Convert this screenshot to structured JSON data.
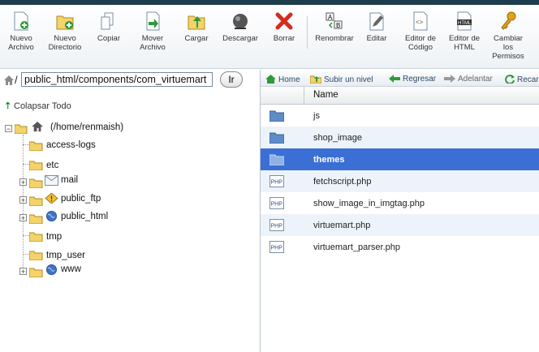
{
  "toolbar": {
    "items": [
      {
        "label": "Nuevo\nArchivo",
        "icon": "new-file-icon"
      },
      {
        "label": "Nuevo\nDirectorio",
        "icon": "new-folder-icon"
      },
      {
        "label": "Copiar",
        "icon": "copy-icon"
      },
      {
        "label": "Mover\nArchivo",
        "icon": "move-file-icon"
      },
      {
        "label": "Cargar",
        "icon": "upload-icon"
      },
      {
        "label": "Descargar",
        "icon": "download-icon"
      },
      {
        "label": "Borrar",
        "icon": "delete-icon"
      },
      {
        "label": "Renombrar",
        "icon": "rename-icon"
      },
      {
        "label": "Editar",
        "icon": "edit-icon"
      },
      {
        "label": "Editor de\nCódigo",
        "icon": "code-editor-icon"
      },
      {
        "label": "Editor de\nHTML",
        "icon": "html-editor-icon"
      },
      {
        "label": "Cambiar\nlos\nPermisos",
        "icon": "permissions-icon"
      }
    ]
  },
  "path": {
    "prefix": "/",
    "value": "public_html/components/com_virtuemart",
    "go_label": "Ir"
  },
  "tree": {
    "collapse_label": "Colapsar Todo",
    "root": "(/home/renmaish)",
    "items": [
      "access-logs",
      "etc",
      "mail",
      "public_ftp",
      "public_html",
      "tmp",
      "tmp_user",
      "www"
    ]
  },
  "nav": {
    "home": "Home",
    "up": "Subir un nivel",
    "back": "Regresar",
    "forward": "Adelantar",
    "reload": "Recargar"
  },
  "grid": {
    "header": "Name",
    "rows": [
      {
        "name": "js",
        "type": "folder"
      },
      {
        "name": "shop_image",
        "type": "folder"
      },
      {
        "name": "themes",
        "type": "folder",
        "selected": true
      },
      {
        "name": "fetchscript.php",
        "type": "php"
      },
      {
        "name": "show_image_in_imgtag.php",
        "type": "php"
      },
      {
        "name": "virtuemart.php",
        "type": "php"
      },
      {
        "name": "virtuemart_parser.php",
        "type": "php"
      }
    ]
  },
  "colors": {
    "selected_row": "#3b6fd6",
    "alt_row": "#edf3fa",
    "topbar": "#1d3d4d"
  }
}
